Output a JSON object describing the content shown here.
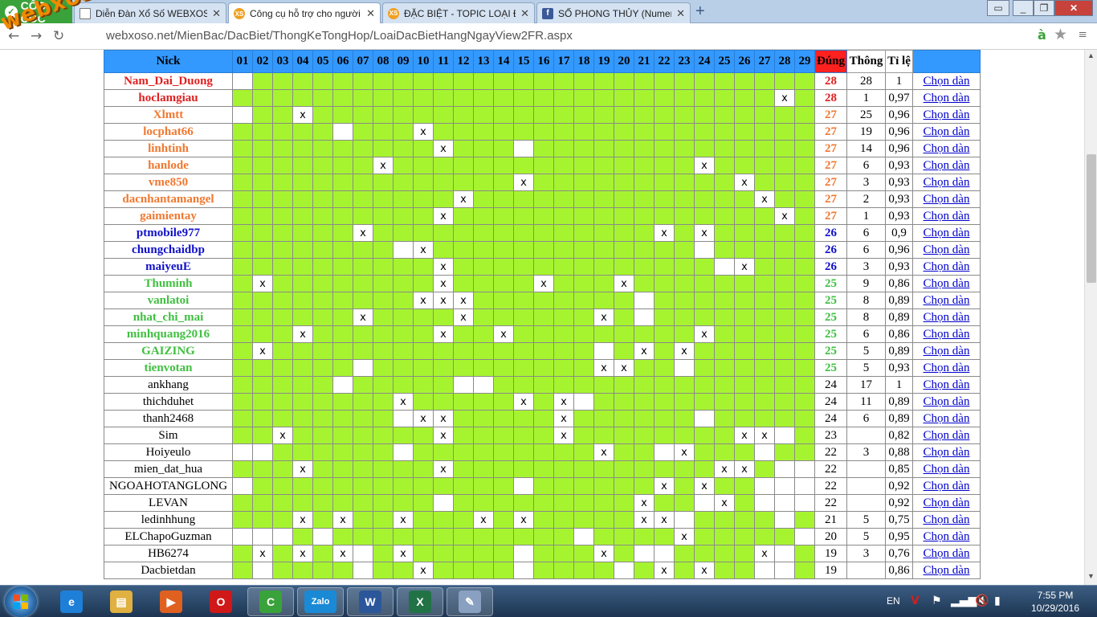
{
  "browser": {
    "brand": "CỐC CỐC",
    "tabs": [
      {
        "label": "Diễn Đàn Xổ Số WEBXOSO.NET",
        "icon": "document-icon",
        "active": false
      },
      {
        "label": "Công cụ hỗ trợ cho người chơi",
        "icon": "xs-icon",
        "active": true
      },
      {
        "label": "ĐẶC BIỆT - TOPIC LOẠI ĐÁ",
        "icon": "xs-icon",
        "active": false
      },
      {
        "label": "SỐ PHONG THỦY (Numerolo",
        "icon": "facebook-icon",
        "active": false
      }
    ],
    "address": "webxoso.net/MienBac/DacBiet/ThongKeTongHop/LoaiDacBietHangNgayView2FR.aspx",
    "watermark": "webxoso.net"
  },
  "table": {
    "headers": {
      "nick": "Nick",
      "days": [
        "01",
        "02",
        "03",
        "04",
        "05",
        "06",
        "07",
        "08",
        "09",
        "10",
        "11",
        "12",
        "13",
        "14",
        "15",
        "16",
        "17",
        "18",
        "19",
        "20",
        "21",
        "22",
        "23",
        "24",
        "25",
        "26",
        "27",
        "28",
        "29"
      ],
      "dung": "Đúng",
      "thong": "Thông",
      "tile": "Tỉ lệ"
    },
    "link_label": "Chọn dàn",
    "rows": [
      {
        "nick": "Nam_Dai_Duong",
        "color": "#e02020",
        "cells": "wggggggggggggggggggggggggggggg",
        "dung": "28",
        "thong": "28",
        "tile": "1"
      },
      {
        "nick": "hoclamgiau",
        "color": "#e02020",
        "cells": "gggggggggggggggggggggggggggxg",
        "dung": "28",
        "thong": "1",
        "tile": "0,97"
      },
      {
        "nick": "Xlmtt",
        "color": "#f07830",
        "cells": "wggxgggggggggggggggggggggggggg",
        "dung": "27",
        "thong": "25",
        "tile": "0,96"
      },
      {
        "nick": "locphat66",
        "color": "#f07830",
        "cells": "gggggwgggxgggggggggggggggggggg",
        "dung": "27",
        "thong": "19",
        "tile": "0,96"
      },
      {
        "nick": "linhtinh",
        "color": "#f07830",
        "cells": "ggggggggggxgggwggggggggggggggg",
        "dung": "27",
        "thong": "14",
        "tile": "0,96"
      },
      {
        "nick": "hanlode",
        "color": "#f07830",
        "cells": "gggggggxgggggggggggggggxgggggg",
        "dung": "27",
        "thong": "6",
        "tile": "0,93"
      },
      {
        "nick": "vme850",
        "color": "#f07830",
        "cells": "ggggggggggggggxggggggggggxgggg",
        "dung": "27",
        "thong": "3",
        "tile": "0,93"
      },
      {
        "nick": "dacnhantamangel",
        "color": "#f07830",
        "cells": "gggggggggggxggggggggggggggxggg",
        "dung": "27",
        "thong": "2",
        "tile": "0,93"
      },
      {
        "nick": "gaimientay",
        "color": "#f07830",
        "cells": "ggggggggggxggggggggggggggggxgg",
        "dung": "27",
        "thong": "1",
        "tile": "0,93"
      },
      {
        "nick": "ptmobile977",
        "color": "#1010c8",
        "cells": "ggggggxggggggggggggggxgxgggggg",
        "dung": "26",
        "thong": "6",
        "tile": "0,9"
      },
      {
        "nick": "chungchaidbp",
        "color": "#1010c8",
        "cells": "ggggggggwxgggggggggggggwgggggg",
        "dung": "26",
        "thong": "6",
        "tile": "0,96"
      },
      {
        "nick": "maiyeuE",
        "color": "#1010c8",
        "cells": "ggggggggggxgggggggggggggwxgggg",
        "dung": "26",
        "thong": "3",
        "tile": "0,93"
      },
      {
        "nick": "Thuminh",
        "color": "#40c040",
        "cells": "gxggggggggxggggxgggxgggggggggg",
        "dung": "25",
        "thong": "9",
        "tile": "0,86"
      },
      {
        "nick": "vanlatoi",
        "color": "#40c040",
        "cells": "gggggggggxxxggggggggwggggggggg",
        "dung": "25",
        "thong": "8",
        "tile": "0,89"
      },
      {
        "nick": "nhat_chi_mai",
        "color": "#40c040",
        "cells": "ggggggxggggxggggggxgwggggggggg",
        "dung": "25",
        "thong": "8",
        "tile": "0,89"
      },
      {
        "nick": "minhquang2016",
        "color": "#40c040",
        "cells": "gggxggggggxggxgggggggggxgggggg",
        "dung": "25",
        "thong": "6",
        "tile": "0,86"
      },
      {
        "nick": "GAIZING",
        "color": "#40c040",
        "cells": "gxggggggggggggggggwgxgxggggggg",
        "dung": "25",
        "thong": "5",
        "tile": "0,89"
      },
      {
        "nick": "tienvotan",
        "color": "#40c040",
        "cells": "ggggggwgggggggggggxxggwggggggg",
        "dung": "25",
        "thong": "5",
        "tile": "0,93"
      },
      {
        "nick": "ankhang",
        "color": "#000000",
        "cells": "gggggwgggggwwggggggggggggggggg",
        "dung": "24",
        "thong": "17",
        "tile": "1"
      },
      {
        "nick": "thichduhet",
        "color": "#000000",
        "cells": "ggggggggxgggggxgxwgggggggggggg",
        "dung": "24",
        "thong": "11",
        "tile": "0,89"
      },
      {
        "nick": "thanh2468",
        "color": "#000000",
        "cells": "ggggggggwxxgggggxggggggwgggggg",
        "dung": "24",
        "thong": "6",
        "tile": "0,89"
      },
      {
        "nick": "Sim",
        "color": "#000000",
        "cells": "ggxgggggggxgggggxggggggggxxwgg",
        "dung": "23",
        "thong": "",
        "tile": "0,82"
      },
      {
        "nick": "Hoiyeulo",
        "color": "#000000",
        "cells": "wwggggggwgggggggggxggwxgggwggg",
        "dung": "22",
        "thong": "3",
        "tile": "0,88"
      },
      {
        "nick": "mien_dat_hua",
        "color": "#000000",
        "cells": "gggxggggggxgggggggggggggxxgwwg",
        "dung": "22",
        "thong": "",
        "tile": "0,85"
      },
      {
        "nick": "NGOAHOTANGLONG",
        "color": "#000000",
        "cells": "wgggggggggggggwggggggxgxggwwwg",
        "dung": "22",
        "thong": "",
        "tile": "0,92"
      },
      {
        "nick": "LEVAN",
        "color": "#000000",
        "cells": "ggggggggggwgggggggggxggwxgwwwg",
        "dung": "22",
        "thong": "",
        "tile": "0,92"
      },
      {
        "nick": "ledinhhung",
        "color": "#000000",
        "cells": "gggxgxggxgggxgxgggggxxwggggwgg",
        "dung": "21",
        "thong": "5",
        "tile": "0,75"
      },
      {
        "nick": "ELChapoGuzman",
        "color": "#000000",
        "cells": "wwwgwggggggggggggwggggxgggggwg",
        "dung": "20",
        "thong": "5",
        "tile": "0,95"
      },
      {
        "nick": "HB6274",
        "color": "#000000",
        "cells": "gxgxgxwgxgggggwgggxgwwggggxwgg",
        "dung": "19",
        "thong": "3",
        "tile": "0,76"
      },
      {
        "nick": "Dacbietdan",
        "color": "#000000",
        "cells": "gwggggwggxggggwggggwgxgxggwwgg",
        "dung": "19",
        "thong": "",
        "tile": "0,86"
      }
    ]
  },
  "taskbar": {
    "apps": [
      {
        "name": "ie-icon",
        "label": "e",
        "color": "#1e7fd8"
      },
      {
        "name": "file-explorer-icon",
        "label": "▤",
        "color": "#e0b040"
      },
      {
        "name": "media-player-icon",
        "label": "▶",
        "color": "#e06020"
      },
      {
        "name": "opera-icon",
        "label": "O",
        "color": "#d01818"
      },
      {
        "name": "coccoc-icon",
        "label": "C",
        "color": "#3aa23a"
      },
      {
        "name": "zalo-icon",
        "label": "Zalo",
        "color": "#1a8ad6"
      },
      {
        "name": "word-icon",
        "label": "W",
        "color": "#2b579a"
      },
      {
        "name": "excel-icon",
        "label": "X",
        "color": "#217346"
      },
      {
        "name": "paint-icon",
        "label": "✎",
        "color": "#8aa0c0"
      }
    ],
    "lang": "EN",
    "time": "7:55 PM",
    "date": "10/29/2016"
  }
}
